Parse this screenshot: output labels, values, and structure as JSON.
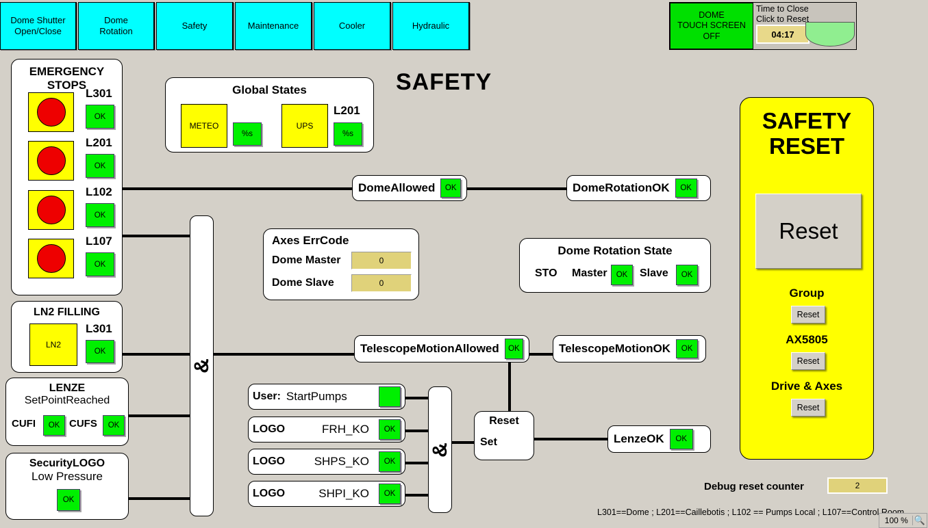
{
  "page": {
    "title": "SAFETY"
  },
  "tabs": [
    {
      "label": "Dome Shutter\nOpen/Close",
      "name": "tab-dome-shutter"
    },
    {
      "label": "Dome\nRotation",
      "name": "tab-dome-rotation"
    },
    {
      "label": "Safety",
      "name": "tab-safety"
    },
    {
      "label": "Maintenance",
      "name": "tab-maintenance"
    },
    {
      "label": "Cooler",
      "name": "tab-cooler"
    },
    {
      "label": "Hydraulic",
      "name": "tab-hydraulic"
    }
  ],
  "dome_header": {
    "touch_screen_label": "DOME\nTOUCH SCREEN\nOFF",
    "time_to_close_label": "Time to Close",
    "click_to_reset_label": "Click to Reset",
    "timer_value": "04:17",
    "dome_shape_icon": "dome-half-circle-icon"
  },
  "emergency_stops": {
    "title": "EMERGENCY\nSTOPS",
    "items": [
      {
        "id": "L301",
        "status": "OK"
      },
      {
        "id": "L201",
        "status": "OK"
      },
      {
        "id": "L102",
        "status": "OK"
      },
      {
        "id": "L107",
        "status": "OK"
      }
    ]
  },
  "global_states": {
    "title": "Global States",
    "meteo_label": "METEO",
    "meteo_status": "%s",
    "ups_label": "UPS",
    "ups_id": "L201",
    "ups_status": "%s"
  },
  "ln2_filling": {
    "title": "LN2 FILLING",
    "tank_label": "LN2",
    "id": "L301",
    "status": "OK"
  },
  "lenze": {
    "title": "LENZE",
    "subtitle": "SetPointReached",
    "cufi_label": "CUFI",
    "cufi_status": "OK",
    "cufs_label": "CUFS",
    "cufs_status": "OK"
  },
  "security_logo": {
    "title": "SecurityLOGO",
    "subtitle": "Low Pressure",
    "status": "OK"
  },
  "axes_errcode": {
    "title": "Axes ErrCode",
    "rows": [
      {
        "label": "Dome Master",
        "value": "0"
      },
      {
        "label": "Dome Slave",
        "value": "0"
      }
    ]
  },
  "dome_rotation_state": {
    "title": "Dome Rotation State",
    "sto_label": "STO",
    "master_label": "Master",
    "master_status": "OK",
    "slave_label": "Slave",
    "slave_status": "OK"
  },
  "signals": {
    "dome_allowed": {
      "label": "DomeAllowed",
      "status": "OK"
    },
    "dome_rotation_ok": {
      "label": "DomeRotationOK",
      "status": "OK"
    },
    "telescope_motion_allowed": {
      "label": "TelescopeMotionAllowed",
      "status": "OK"
    },
    "telescope_motion_ok": {
      "label": "TelescopeMotionOK",
      "status": "OK"
    },
    "lenze_ok": {
      "label": "LenzeOK",
      "status": "OK"
    }
  },
  "logic_inputs": [
    {
      "prefix": "User:",
      "label": "StartPumps",
      "status": ""
    },
    {
      "prefix": "LOGO",
      "label": "FRH_KO",
      "status": "OK"
    },
    {
      "prefix": "LOGO",
      "label": "SHPS_KO",
      "status": "OK"
    },
    {
      "prefix": "LOGO",
      "label": "SHPI_KO",
      "status": "OK"
    }
  ],
  "and_gates": {
    "symbol": "&"
  },
  "rs_latch": {
    "reset_label": "Reset",
    "set_label": "Set"
  },
  "safety_reset": {
    "title": "SAFETY\nRESET",
    "main_button": "Reset",
    "group_label": "Group",
    "group_button": "Reset",
    "ax_label": "AX5805",
    "ax_button": "Reset",
    "drive_label": "Drive & Axes",
    "drive_button": "Reset"
  },
  "debug": {
    "label": "Debug reset counter",
    "value": "2"
  },
  "footer": {
    "legend": "L301==Dome ; L201==Caillebotis ; L102 == Pumps Local ; L107==Control Room"
  },
  "status_bar": {
    "zoom": "100 %",
    "zoom_icon": "magnifier-icon"
  }
}
